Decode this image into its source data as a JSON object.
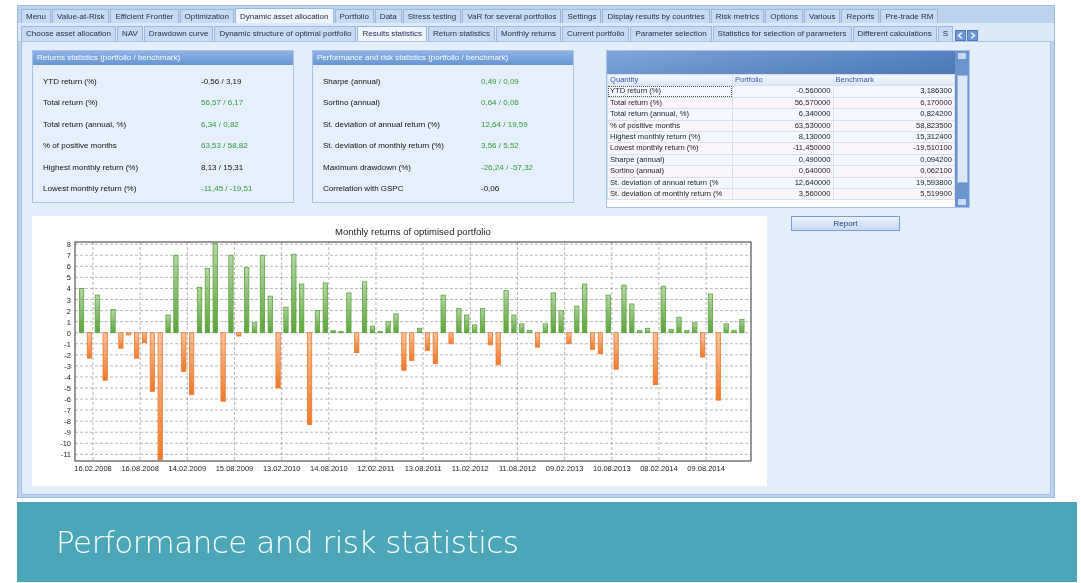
{
  "tabs_main": [
    {
      "label": "Menu",
      "selected": false
    },
    {
      "label": "Value-at-Risk",
      "selected": false
    },
    {
      "label": "Efficient Frontier",
      "selected": false
    },
    {
      "label": "Optimization",
      "selected": false
    },
    {
      "label": "Dynamic asset allocation",
      "selected": true
    },
    {
      "label": "Portfolio",
      "selected": false
    },
    {
      "label": "Data",
      "selected": false
    },
    {
      "label": "Stress testing",
      "selected": false
    },
    {
      "label": "VaR for several portfolios",
      "selected": false
    },
    {
      "label": "Settings",
      "selected": false
    },
    {
      "label": "Display results by countries",
      "selected": false
    },
    {
      "label": "Risk metrics",
      "selected": false
    },
    {
      "label": "Options",
      "selected": false
    },
    {
      "label": "Various",
      "selected": false
    },
    {
      "label": "Reports",
      "selected": false
    },
    {
      "label": "Pre-trade RM",
      "selected": false
    }
  ],
  "tabs_sub": [
    {
      "label": "Choose asset allocation",
      "selected": false
    },
    {
      "label": "NAV",
      "selected": false
    },
    {
      "label": "Drawdown curve",
      "selected": false
    },
    {
      "label": "Dynamic structure of optimal portfolio",
      "selected": false
    },
    {
      "label": "Results statistics",
      "selected": true
    },
    {
      "label": "Return statistics",
      "selected": false
    },
    {
      "label": "Monthly returns",
      "selected": false
    },
    {
      "label": "Current portfolio",
      "selected": false
    },
    {
      "label": "Parameter selection",
      "selected": false
    },
    {
      "label": "Statistics for selection of parameters",
      "selected": false
    },
    {
      "label": "Different calculations",
      "selected": false
    },
    {
      "label": "S",
      "selected": false
    }
  ],
  "panels": [
    {
      "title": "Returns statistics (portfolio / benchmark)",
      "rows": [
        {
          "label": "YTD return (%)",
          "value": "-0,56 / 3,19",
          "highlighted": false
        },
        {
          "label": "Total return (%)",
          "value": "56,57 / 6,17",
          "highlighted": true
        },
        {
          "label": "Total return (annual, %)",
          "value": "6,34 / 0,82",
          "highlighted": true
        },
        {
          "label": "% of positive months",
          "value": "63,53 / 58,82",
          "highlighted": true
        },
        {
          "label": "Highest monthly return (%)",
          "value": "8,13 / 15,31",
          "highlighted": false
        },
        {
          "label": "Lowest monthly return (%)",
          "value": "-11,45 / -19,51",
          "highlighted": true
        }
      ]
    },
    {
      "title": "Performance and risk statistics (portfolio / benchmark)",
      "rows": [
        {
          "label": "Sharpe (annual)",
          "value": "0,49 / 0,09",
          "highlighted": true
        },
        {
          "label": "Sortino (annual)",
          "value": "0,64 / 0,06",
          "highlighted": true
        },
        {
          "label": "St. deviation of annual return (%)",
          "value": "12,64 / 19,59",
          "highlighted": true
        },
        {
          "label": "St. deviation of monthly return (%)",
          "value": "3,56 / 5,52",
          "highlighted": true
        },
        {
          "label": "Maximum drawdown (%)",
          "value": "-26,24 / -57,32",
          "highlighted": true
        },
        {
          "label": "Correlation with GSPC",
          "value": "-0,06",
          "highlighted": false
        }
      ]
    }
  ],
  "table": {
    "columns": [
      "Quantity",
      "Portfolio",
      "Benchmark"
    ],
    "rows": [
      {
        "cells": [
          "YTD return (%)",
          "-0,560000",
          "3,186300"
        ],
        "selected": true
      },
      {
        "cells": [
          "Total return (%)",
          "56,570000",
          "6,170000"
        ],
        "selected": false
      },
      {
        "cells": [
          "Total return (annual, %)",
          "6,340000",
          "0,824200"
        ],
        "selected": false
      },
      {
        "cells": [
          "% of positive months",
          "63,530000",
          "58,823500"
        ],
        "selected": false
      },
      {
        "cells": [
          "Highest monthly return (%)",
          "8,130000",
          "15,312400"
        ],
        "selected": false
      },
      {
        "cells": [
          "Lowest monthly return (%)",
          "-11,450000",
          "-19,510100"
        ],
        "selected": false
      },
      {
        "cells": [
          "Sharpe (annual)",
          "0,490000",
          "0,094200"
        ],
        "selected": false
      },
      {
        "cells": [
          "Sortino (annual)",
          "0,640000",
          "0,062100"
        ],
        "selected": false
      },
      {
        "cells": [
          "St. deviation of annual return (%",
          "12,640000",
          "19,593800"
        ],
        "selected": false
      },
      {
        "cells": [
          "St. deviation of monthly return (%",
          "3,560000",
          "5,519900"
        ],
        "selected": false
      }
    ]
  },
  "report_button": "Report",
  "chart": {
    "chart_data": {
      "type": "bar",
      "title": "Monthly returns of optimised portfolio",
      "categories": [
        null,
        null,
        "16.02.2008",
        null,
        null,
        null,
        null,
        null,
        "16.08.2008",
        null,
        null,
        null,
        null,
        null,
        "14.02.2009",
        null,
        null,
        null,
        null,
        null,
        "15.08.2009",
        null,
        null,
        null,
        null,
        null,
        "13.02.2010",
        null,
        null,
        null,
        null,
        null,
        "14.08.2010",
        null,
        null,
        null,
        null,
        null,
        "12.02.2011",
        null,
        null,
        null,
        null,
        null,
        "13.08.2011",
        null,
        null,
        null,
        null,
        null,
        "11.02.2012",
        null,
        null,
        null,
        null,
        null,
        "11.08.2012",
        null,
        null,
        null,
        null,
        null,
        "09.02.2013",
        null,
        null,
        null,
        null,
        null,
        "10.08.2013",
        null,
        null,
        null,
        null,
        null,
        "08.02.2014",
        null,
        null,
        null,
        null,
        null,
        "09.08.2014",
        null,
        null,
        null,
        null
      ],
      "series": [
        {
          "color": "#5aa63a",
          "values": [
            4.0,
            null,
            3.4,
            null,
            2.1,
            null,
            null,
            null,
            null,
            null,
            null,
            1.6,
            7.0,
            null,
            null,
            4.1,
            5.8,
            8.1,
            null,
            7.0,
            null,
            5.9,
            0.9,
            7.0,
            3.3,
            null,
            2.3,
            7.1,
            4.4,
            null,
            2.0,
            4.5,
            0.2,
            0.1,
            3.6,
            null,
            4.6,
            0.6,
            0.1,
            1.0,
            1.7,
            null,
            null,
            0.4,
            null,
            null,
            3.4,
            null,
            2.2,
            1.6,
            0.7,
            2.2,
            null,
            null,
            3.8,
            1.6,
            0.8,
            0.2,
            null,
            0.8,
            3.6,
            2.0,
            null,
            2.4,
            4.4,
            null,
            null,
            3.4,
            null,
            4.3,
            2.6,
            0.2,
            0.4,
            null,
            4.2,
            0.3,
            1.4,
            0.2,
            0.9,
            null,
            3.5,
            null,
            0.8,
            0.2,
            1.2
          ]
        },
        {
          "color": "#f07a2a",
          "values": [
            null,
            -2.3,
            null,
            -4.3,
            null,
            -1.4,
            -0.2,
            -2.3,
            -0.9,
            -5.3,
            -11.5,
            null,
            null,
            -3.5,
            -5.6,
            null,
            null,
            null,
            -6.2,
            null,
            -0.3,
            null,
            null,
            null,
            null,
            -5.0,
            null,
            null,
            null,
            -8.3,
            null,
            null,
            null,
            null,
            null,
            -1.8,
            null,
            null,
            null,
            null,
            null,
            -3.4,
            -2.5,
            null,
            -1.6,
            -2.8,
            null,
            -1.0,
            null,
            null,
            null,
            null,
            -1.1,
            -2.9,
            null,
            null,
            null,
            null,
            -1.3,
            null,
            null,
            null,
            -1.0,
            null,
            null,
            -1.5,
            -1.9,
            null,
            -3.3,
            null,
            null,
            null,
            null,
            -4.7,
            null,
            null,
            null,
            null,
            null,
            -2.2,
            null,
            -6.1,
            null,
            null,
            null
          ]
        }
      ],
      "grid": true,
      "ylim": [
        -11.6,
        8.2
      ],
      "yticks": [
        -11,
        -10,
        -9,
        -8,
        -7,
        -6,
        -5,
        -4,
        -3,
        -2,
        -1,
        0,
        1,
        2,
        3,
        4,
        5,
        6,
        7,
        8
      ]
    }
  },
  "caption": "Performance and risk statistics"
}
